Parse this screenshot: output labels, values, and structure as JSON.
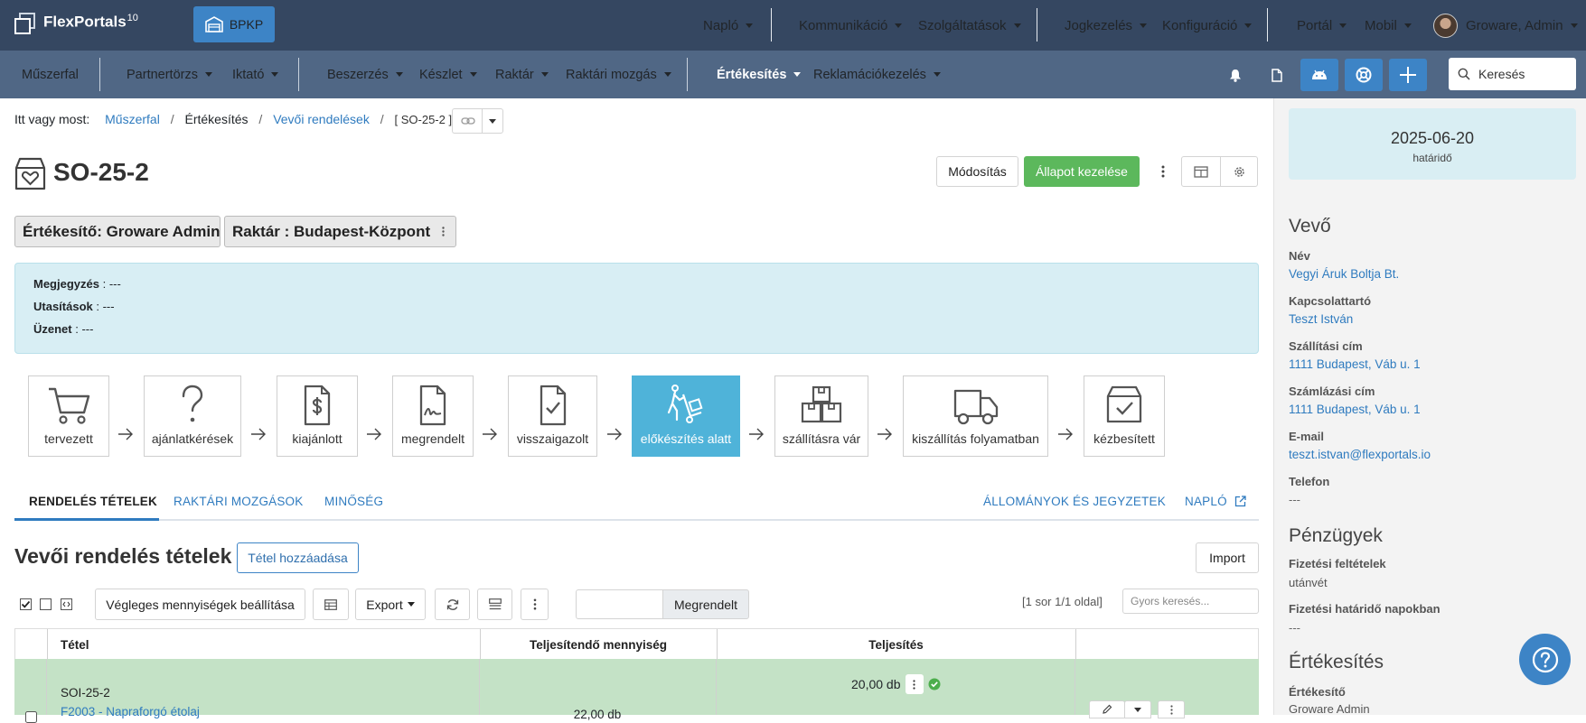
{
  "app": {
    "logo_text": "FlexPortals",
    "logo_version": "10",
    "company_button": "BPKP"
  },
  "top_nav": {
    "items": [
      "Napló",
      "Kommunikáció",
      "Szolgáltatások",
      "Jogkezelés",
      "Konfiguráció",
      "Portál",
      "Mobil"
    ],
    "user": "Groware, Admin"
  },
  "sub_nav": {
    "items": [
      "Műszerfal",
      "Partnertörzs",
      "Iktató",
      "Beszerzés",
      "Készlet",
      "Raktár",
      "Raktári mozgás",
      "Értékesítés",
      "Reklamációkezelés"
    ],
    "active": "Értékesítés",
    "search_placeholder": "Keresés"
  },
  "breadcrumb": {
    "prefix": "Itt vagy most:",
    "items": [
      "Műszerfal",
      "Értékesítés",
      "Vevői rendelések",
      "[ SO-25-2 ]"
    ]
  },
  "page": {
    "title": "SO-25-2",
    "edit_button": "Módosítás",
    "state_button": "Állapot kezelése"
  },
  "tags": {
    "seller": "Értékesítő: Groware Admin",
    "warehouse": "Raktár : Budapest-Központ"
  },
  "notes": [
    {
      "label": "Megjegyzés",
      "value": " : ---"
    },
    {
      "label": "Utasítások",
      "value": " : ---"
    },
    {
      "label": "Üzenet",
      "value": " : ---"
    }
  ],
  "workflow": {
    "steps": [
      "tervezett",
      "ajánlatkérések",
      "kiajánlott",
      "megrendelt",
      "visszaigazolt",
      "előkészítés alatt",
      "szállításra vár",
      "kiszállítás folyamatban",
      "kézbesített"
    ],
    "active": "előkészítés alatt"
  },
  "tabs": {
    "left": [
      "RENDELÉS TÉTELEK",
      "RAKTÁRI MOZGÁSOK",
      "MINŐSÉG"
    ],
    "active": "RENDELÉS TÉTELEK",
    "right": [
      "ÁLLOMÁNYOK ÉS JEGYZETEK",
      "NAPLÓ"
    ]
  },
  "section": {
    "title": "Vevői rendelés tételek",
    "add_button": "Tétel hozzáadása",
    "import_button": "Import"
  },
  "toolbar": {
    "final_qty_button": "Végleges mennyiségek beállítása",
    "export_button": "Export",
    "filter_value": "Megrendelt",
    "paging": "[1 sor 1/1 oldal]",
    "quick_search_placeholder": "Gyors keresés..."
  },
  "table": {
    "headers": [
      "Tétel",
      "Teljesítendő mennyiség",
      "Teljesítés"
    ],
    "rows": [
      {
        "code": "SOI-25-2",
        "product": "F2003 - Napraforgó étolaj",
        "qty": "22,00 db",
        "done": "20,00 db"
      }
    ]
  },
  "right_panel": {
    "deadline": {
      "date": "2025-06-20",
      "label": "határidő"
    },
    "customer_heading": "Vevő",
    "customer": [
      {
        "label": "Név",
        "value": "Vegyi Áruk Boltja Bt.",
        "link": true
      },
      {
        "label": "Kapcsolattartó",
        "value": "Teszt István",
        "link": true
      },
      {
        "label": "Szállítási cím",
        "value": "1111 Budapest, Váb u. 1",
        "link": true
      },
      {
        "label": "Számlázási cím",
        "value": "1111 Budapest, Váb u. 1",
        "link": true
      },
      {
        "label": "E-mail",
        "value": "teszt.istvan@flexportals.io",
        "link": true
      },
      {
        "label": "Telefon",
        "value": "---",
        "link": false
      }
    ],
    "finance_heading": "Pénzügyek",
    "finance": [
      {
        "label": "Fizetési feltételek",
        "value": "utánvét"
      },
      {
        "label": "Fizetési határidő napokban",
        "value": "---"
      }
    ],
    "sales_heading": "Értékesítés",
    "sales": [
      {
        "label": "Értékesítő",
        "value": "Groware Admin"
      }
    ]
  },
  "colors": {
    "topbar": "#354761",
    "subbar": "#506785",
    "accent": "#3d84c6",
    "success": "#5cb85c",
    "active_step": "#4fb3d9",
    "row_bg": "#c4e2c6"
  }
}
